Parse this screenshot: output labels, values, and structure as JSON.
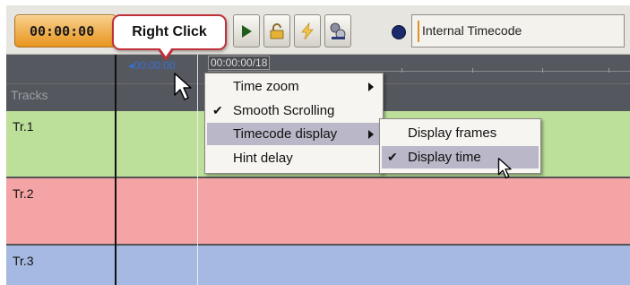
{
  "toolbar": {
    "time_value": "00:00:00",
    "timecode_source": "Internal Timecode",
    "buttons": [
      "play-icon",
      "lock-icon",
      "lightning-icon",
      "sync-icon"
    ]
  },
  "callout": {
    "text": "Right Click"
  },
  "ruler": {
    "start_time": "00:00:00",
    "end_time": "00:00:00/18"
  },
  "tracks": {
    "header": "Tracks",
    "items": [
      {
        "label": "Tr.1",
        "color": "#bcdf9a"
      },
      {
        "label": "Tr.2",
        "color": "#f5a4a5"
      },
      {
        "label": "Tr.3",
        "color": "#a5b9e2"
      }
    ]
  },
  "context_menu": {
    "items": [
      {
        "label": "Time zoom",
        "checked": false,
        "submenu": true
      },
      {
        "label": "Smooth Scrolling",
        "checked": true,
        "submenu": false
      },
      {
        "label": "Timecode display",
        "checked": false,
        "submenu": true,
        "highlighted": true
      },
      {
        "label": "Hint delay",
        "checked": false,
        "submenu": false
      }
    ]
  },
  "submenu": {
    "items": [
      {
        "label": "Display frames",
        "checked": false
      },
      {
        "label": "Display time",
        "checked": true,
        "highlighted": true
      }
    ]
  },
  "glyphs": {
    "check": "✔"
  },
  "colors": {
    "accent": "#e8951e",
    "callout_border": "#c0303a",
    "menu_highlight": "#b9b7c8"
  }
}
